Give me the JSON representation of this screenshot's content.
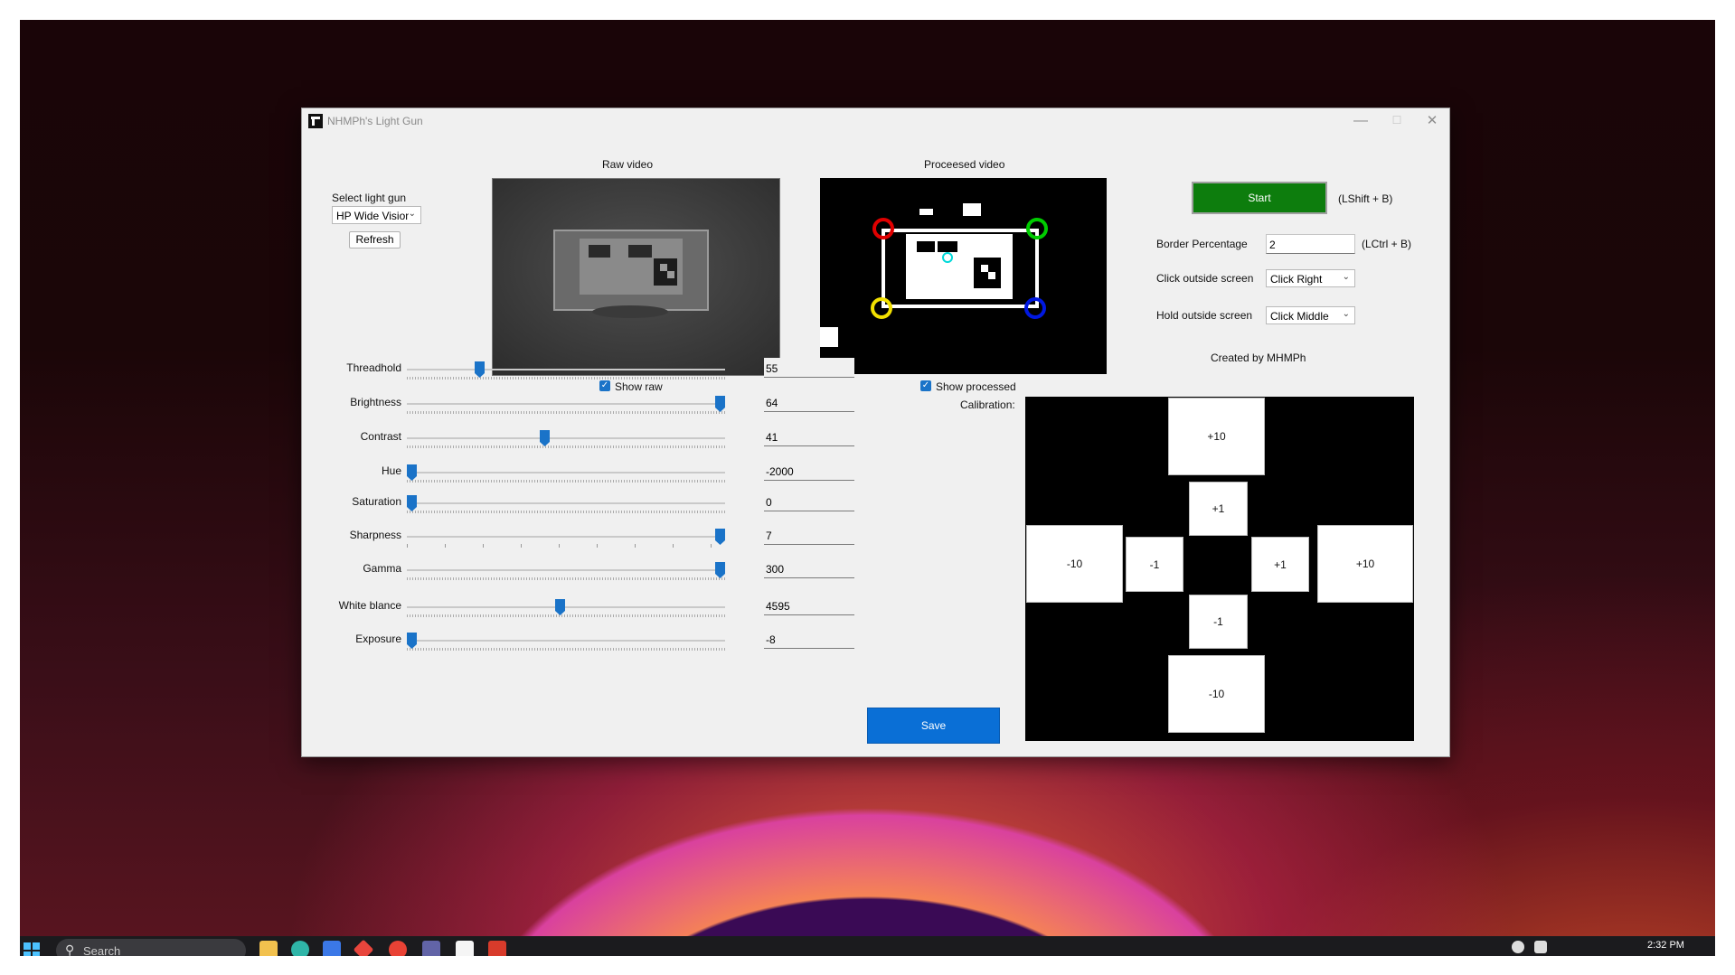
{
  "window": {
    "title": "NHMPh's Light Gun"
  },
  "left_panel": {
    "select_label": "Select light gun",
    "camera_value": "HP Wide Vision HD",
    "refresh_label": "Refresh"
  },
  "videos": {
    "raw_title": "Raw video",
    "processed_title": "Proceesed video",
    "show_raw_label": "Show raw",
    "show_processed_label": "Show processed"
  },
  "sliders": [
    {
      "label": "Threadhold",
      "value": "55",
      "fraction": 0.22
    },
    {
      "label": "Brightness",
      "value": "64",
      "fraction": 1.0
    },
    {
      "label": "Contrast",
      "value": "41",
      "fraction": 0.43
    },
    {
      "label": "Hue",
      "value": "-2000",
      "fraction": 0.0
    },
    {
      "label": "Saturation",
      "value": "0",
      "fraction": 0.0
    },
    {
      "label": "Sharpness",
      "value": "7",
      "fraction": 1.0
    },
    {
      "label": "Gamma",
      "value": "300",
      "fraction": 1.0
    },
    {
      "label": "White blance",
      "value": "4595",
      "fraction": 0.48
    },
    {
      "label": "Exposure",
      "value": "-8",
      "fraction": 0.0
    }
  ],
  "right_panel": {
    "start_label": "Start",
    "start_shortcut": "(LShift + B)",
    "border_label": "Border Percentage",
    "border_value": "2",
    "border_shortcut": "(LCtrl + B)",
    "click_outside_label": "Click outside screen",
    "click_outside_value": "Click Right",
    "hold_outside_label": "Hold outside screen",
    "hold_outside_value": "Click Middle",
    "created_by": "Created by MHMPh"
  },
  "calibration": {
    "label": "Calibration:",
    "up10": "+10",
    "up1": "+1",
    "left10": "-10",
    "left1": "-1",
    "right1": "+1",
    "right10": "+10",
    "down1": "-1",
    "down10": "-10"
  },
  "save_label": "Save",
  "taskbar": {
    "search_placeholder": "Search",
    "time": "2:32 PM"
  },
  "colors": {
    "start_green": "#0d7d0d",
    "save_blue": "#0a6fd6",
    "accent_blue": "#1a73c8"
  }
}
